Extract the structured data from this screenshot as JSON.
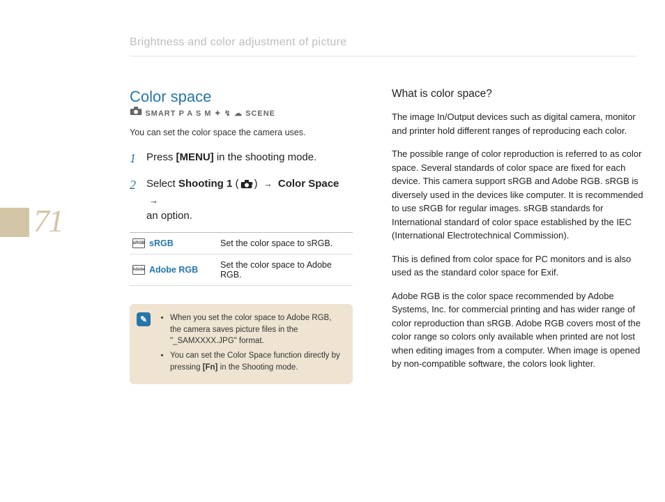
{
  "header": "Brightness and color adjustment of picture",
  "pageNumber": "71",
  "left": {
    "title": "Color space",
    "modeStrip": "SMART P A S M ✦ ↯ ☁ SCENE",
    "intro": "You can set the color space the camera uses.",
    "steps": [
      {
        "num": "1",
        "pre": "Press ",
        "bold": "[MENU]",
        "post": " in the shooting mode."
      },
      {
        "num": "2",
        "pre": "Select ",
        "bold": "Shooting 1",
        "mid": " (",
        "hasCam": true,
        "mid2": ") ",
        "bold2": "Color Space",
        "post": " an option.",
        "hasArrow": true
      }
    ],
    "options": [
      {
        "name": "sRGB",
        "desc": "Set the color space to sRGB."
      },
      {
        "name": "Adobe RGB",
        "desc": "Set the color space to Adobe RGB."
      }
    ],
    "notes": [
      {
        "pre": "When you set the color space to Adobe RGB, the camera saves picture files in the \"_SAMXXXX.JPG\" format."
      },
      {
        "pre": "You can set the Color Space function directly by pressing ",
        "bold": "[Fn]",
        "post": " in the Shooting mode."
      }
    ]
  },
  "right": {
    "heading": "What is color space?",
    "p1": "The image In/Output devices such as digital camera, monitor and printer hold different ranges of reproducing each color.",
    "p2": "The possible range of color reproduction is referred to as color space. Several standards of color space are fixed for each device. This camera support sRGB and Adobe RGB. sRGB is diversely used in the devices like computer. It is recommended to use sRGB for regular images. sRGB standards for International standard of color space established by the IEC (International Electrotechnical Commission).",
    "p3": "This is defined from color space for PC monitors and is also used as the standard color space for Exif.",
    "p4": "Adobe RGB is the color space recommended by Adobe Systems, Inc. for commercial printing and has wider range of color reproduction than sRGB. Adobe RGB covers most of the color range so colors only available when printed are not lost when editing images from a computer. When image is opened by non-compatible software, the colors look lighter."
  }
}
